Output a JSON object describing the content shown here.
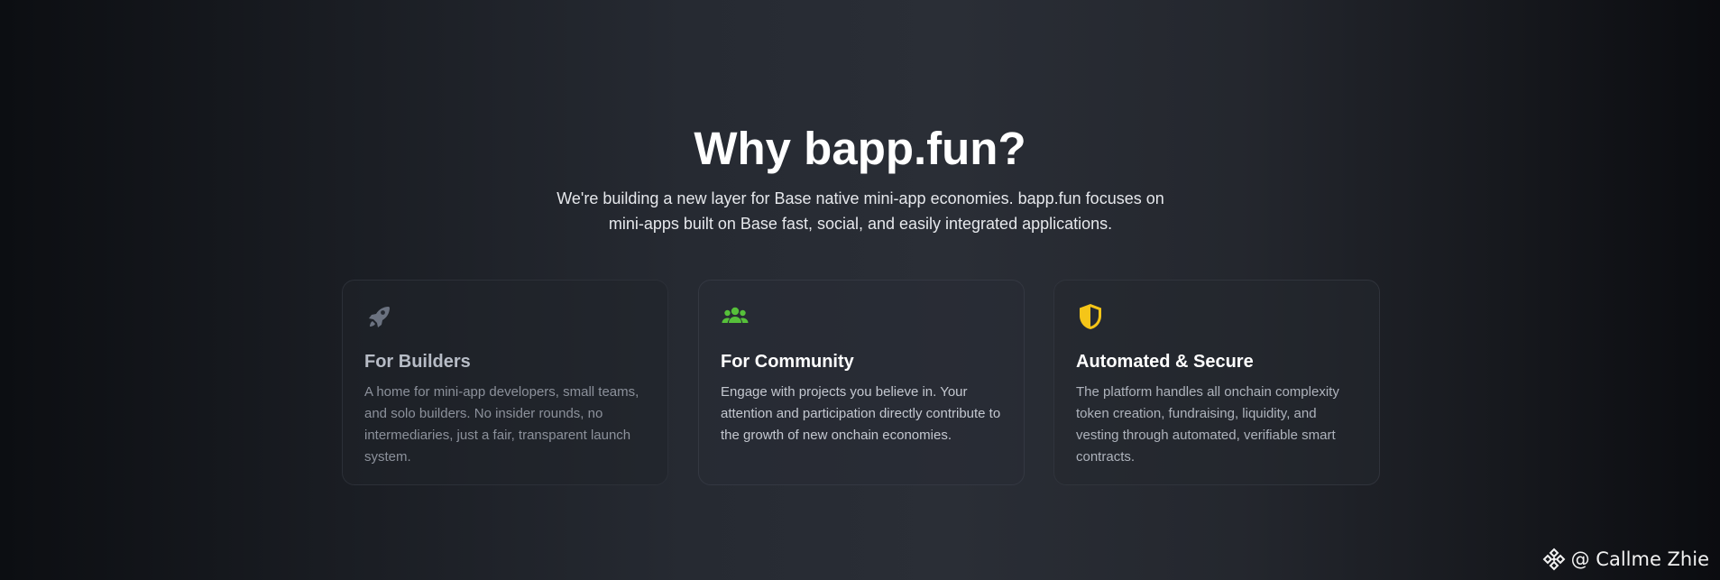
{
  "header": {
    "title": "Why bapp.fun?",
    "subtitle": "We're building a new layer for Base native mini-app economies. bapp.fun focuses on mini-apps built on Base fast, social, and easily integrated applications."
  },
  "features": [
    {
      "icon": "rocket-icon",
      "icon_color": "#6b7280",
      "title": "For Builders",
      "description": "A home for mini-app developers, small teams, and solo builders. No insider rounds, no intermediaries, just a fair, transparent launch system."
    },
    {
      "icon": "users-icon",
      "icon_color": "#56c03a",
      "title": "For Community",
      "description": "Engage with projects you believe in. Your attention and participation directly contribute to the growth of new onchain economies."
    },
    {
      "icon": "shield-icon",
      "icon_color": "#f5c518",
      "title": "Automated & Secure",
      "description": "The platform handles all onchain complexity token creation, fundraising, liquidity, and vesting through automated, verifiable smart contracts."
    }
  ],
  "watermark": {
    "icon": "binance-logo-icon",
    "text": "@ Callme Zhie"
  }
}
